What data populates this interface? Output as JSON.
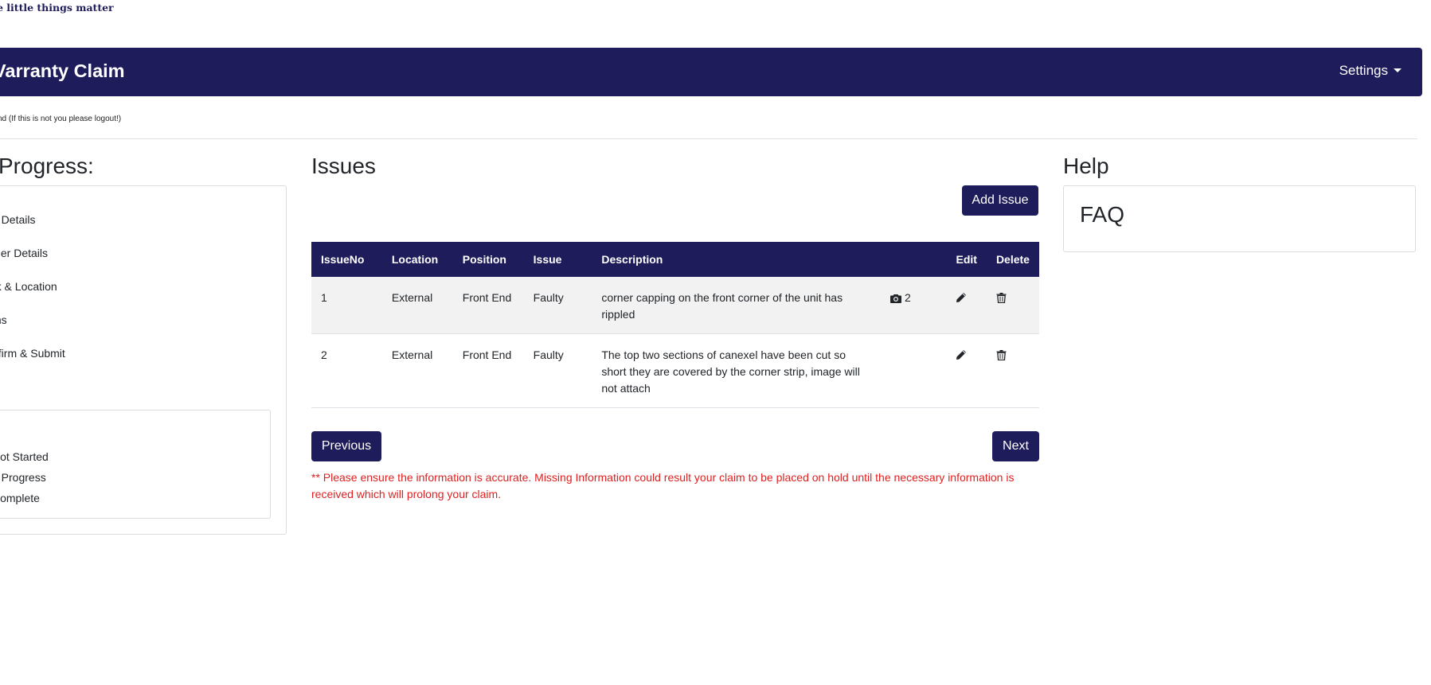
{
  "brand": {
    "tagline": "e little things matter"
  },
  "header": {
    "title": "Varranty Claim",
    "settings_label": "Settings"
  },
  "user_note": "nd (If this is not you please logout!)",
  "progress": {
    "heading": "Progress:",
    "steps": [
      "n Details",
      "aler Details",
      "rk & Location",
      "ms",
      "nfirm & Submit"
    ],
    "legend": [
      "Not Started",
      "n Progress",
      "Complete"
    ]
  },
  "issues": {
    "heading": "Issues",
    "add_label": "Add Issue",
    "columns": [
      "IssueNo",
      "Location",
      "Position",
      "Issue",
      "Description",
      "",
      "Edit",
      "Delete"
    ],
    "rows": [
      {
        "no": "1",
        "location": "External",
        "position": "Front End",
        "issue": "Faulty",
        "description": "corner capping on the front corner of the unit has rippled",
        "photos": "2"
      },
      {
        "no": "2",
        "location": "External",
        "position": "Front End",
        "issue": "Faulty",
        "description": "The top two sections of canexel have been cut so short they are covered by the corner strip, image will not attach",
        "photos": ""
      }
    ],
    "icons": {
      "photo": "camera-icon",
      "edit": "pencil-icon",
      "delete": "trash-icon"
    },
    "previous_label": "Previous",
    "next_label": "Next",
    "warning": "** Please ensure the information is accurate. Missing Information could result your claim to be placed on hold until the necessary information is received which will prolong your claim."
  },
  "help": {
    "heading": "Help",
    "faq_title": "FAQ"
  },
  "colors": {
    "brand": "#1e1c5a",
    "warning": "#e02020",
    "row_stripe": "#f2f2f2"
  }
}
